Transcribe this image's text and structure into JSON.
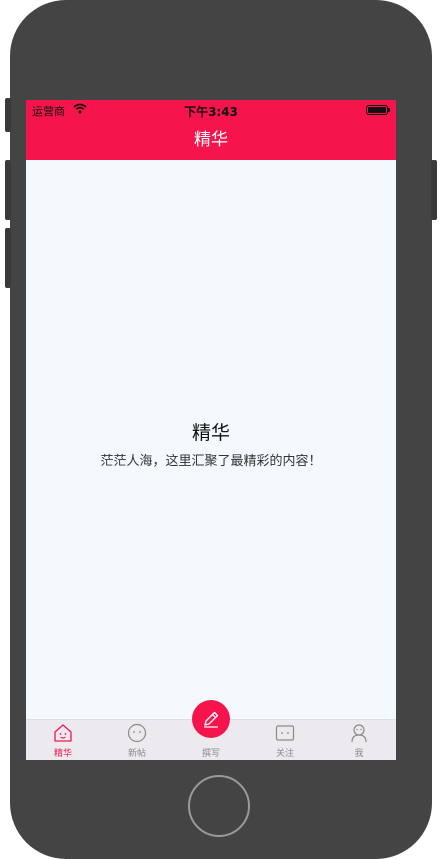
{
  "status_bar": {
    "carrier": "运营商",
    "time": "下午3:43"
  },
  "nav": {
    "title": "精华"
  },
  "content": {
    "title": "精华",
    "subtitle": "茫茫人海，这里汇聚了最精彩的内容！"
  },
  "tabs": [
    {
      "label": "精华",
      "icon": "house-face-icon",
      "active": true
    },
    {
      "label": "新帖",
      "icon": "smiley-face-icon",
      "active": false
    },
    {
      "label": "撰写",
      "icon": "pencil-icon",
      "active": false
    },
    {
      "label": "关注",
      "icon": "box-face-icon",
      "active": false
    },
    {
      "label": "我",
      "icon": "person-icon",
      "active": false
    }
  ],
  "colors": {
    "accent": "#f5154c",
    "background": "#f3f9fc",
    "tab_bar": "#ece9ef",
    "inactive": "#8a8a8a",
    "device": "#444444"
  }
}
